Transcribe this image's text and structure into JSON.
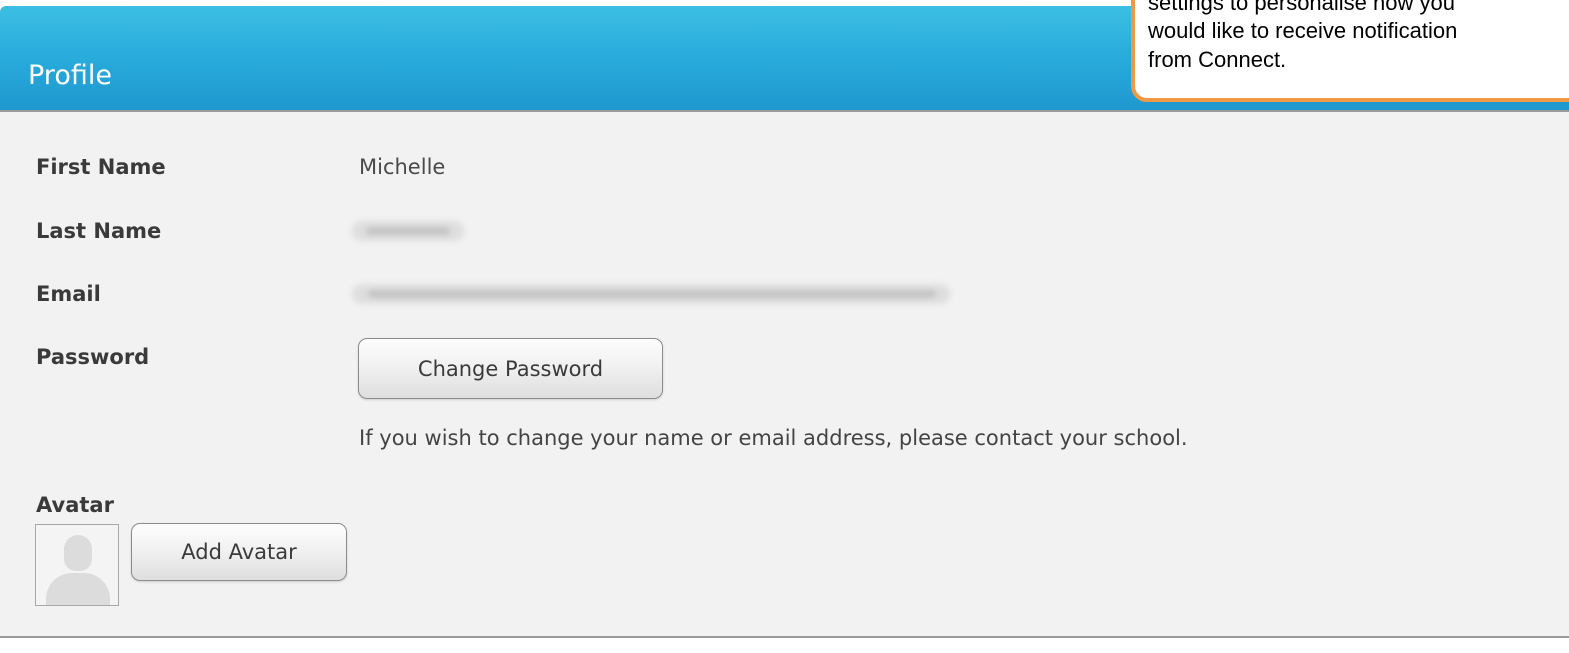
{
  "header": {
    "title": "Profile"
  },
  "profile": {
    "first_name_label": "First Name",
    "first_name_value": "Michelle",
    "last_name_label": "Last Name",
    "email_label": "Email",
    "password_label": "Password",
    "change_password_button": "Change Password",
    "hint": "If you wish to change your name or email address, please contact your school.",
    "avatar_label": "Avatar",
    "add_avatar_button": "Add Avatar"
  },
  "callout": {
    "lines": [
      "settings to personalise how you",
      "would like to receive notification",
      "from Connect."
    ]
  }
}
